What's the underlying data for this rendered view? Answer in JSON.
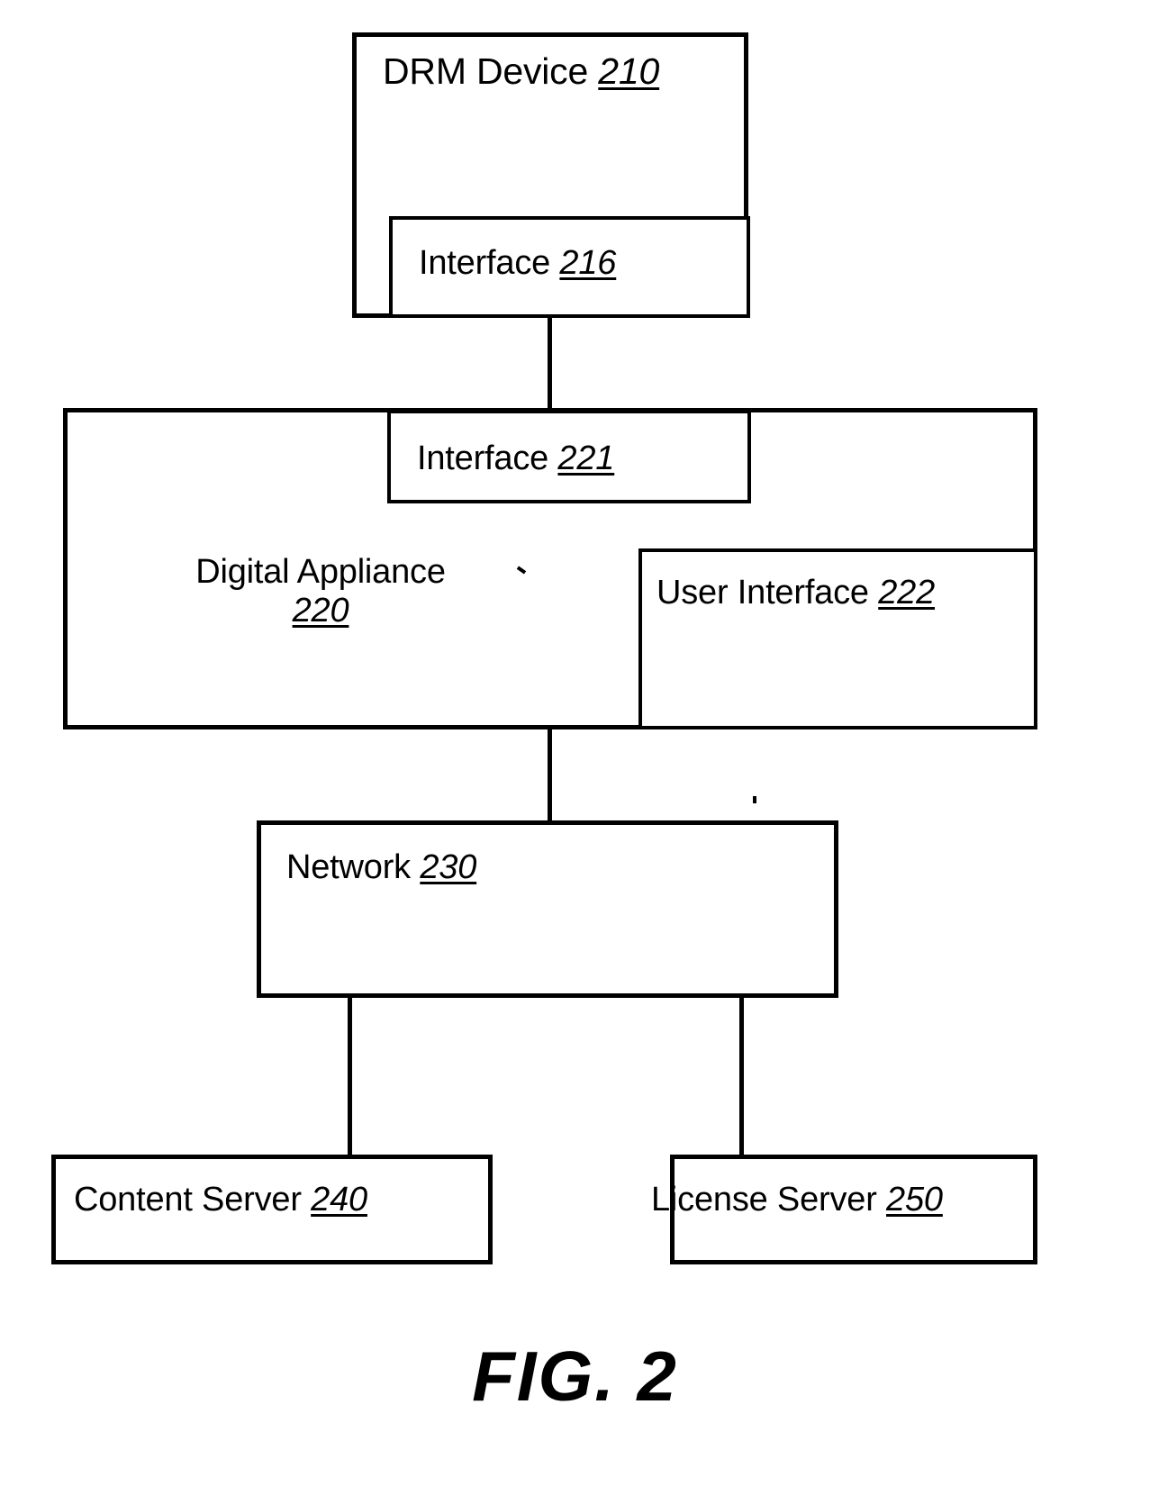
{
  "figure": {
    "caption": "FIG. 2",
    "title": "DRM Device / Digital Appliance / Network block diagram"
  },
  "nodes": {
    "drm_device": {
      "name": "DRM Device",
      "ref": "210",
      "label": "DRM Device 210"
    },
    "interface_216": {
      "name": "Interface",
      "ref": "216",
      "label": "Interface 216"
    },
    "digital_appliance": {
      "name": "Digital Appliance",
      "ref": "220",
      "label": "Digital Appliance 220"
    },
    "interface_221": {
      "name": "Interface",
      "ref": "221",
      "label": "Interface 221"
    },
    "user_interface_222": {
      "name": "User Interface",
      "ref": "222",
      "label": "User Interface 222"
    },
    "network": {
      "name": "Network",
      "ref": "230",
      "label": "Network 230"
    },
    "content_server": {
      "name": "Content Server",
      "ref": "240",
      "label": "Content Server 240"
    },
    "license_server": {
      "name": "License Server",
      "ref": "250",
      "label": "License Server 250"
    }
  },
  "connections": [
    {
      "from": "interface_216",
      "to": "interface_221"
    },
    {
      "from": "digital_appliance",
      "to": "network"
    },
    {
      "from": "network",
      "to": "content_server"
    },
    {
      "from": "network",
      "to": "license_server"
    }
  ],
  "colors": {
    "stroke": "#000000",
    "background": "#ffffff"
  }
}
